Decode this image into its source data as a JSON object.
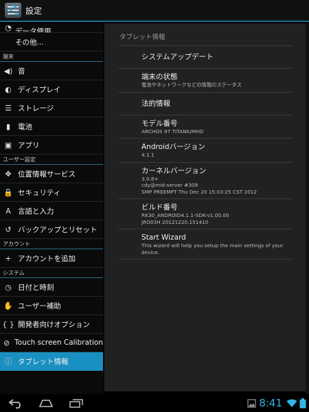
{
  "actionbar": {
    "title": "設定"
  },
  "sidebar": {
    "partial_item": "データ使用",
    "items_top": [
      {
        "label": "その他...",
        "icon": "none"
      }
    ],
    "sections": [
      {
        "header": "端末",
        "items": [
          {
            "label": "音",
            "icon": "speaker-icon",
            "glyph": "◀)"
          },
          {
            "label": "ディスプレイ",
            "icon": "brightness-icon",
            "glyph": "◐"
          },
          {
            "label": "ストレージ",
            "icon": "storage-icon",
            "glyph": "☰"
          },
          {
            "label": "電池",
            "icon": "battery-icon",
            "glyph": "▮"
          },
          {
            "label": "アプリ",
            "icon": "apps-icon",
            "glyph": "▣"
          }
        ]
      },
      {
        "header": "ユーザー設定",
        "items": [
          {
            "label": "位置情報サービス",
            "icon": "location-icon",
            "glyph": "✥"
          },
          {
            "label": "セキュリティ",
            "icon": "lock-icon",
            "glyph": "🔒"
          },
          {
            "label": "言語と入力",
            "icon": "keyboard-icon",
            "glyph": "A"
          },
          {
            "label": "バックアップとリセット",
            "icon": "backup-icon",
            "glyph": "↺"
          }
        ]
      },
      {
        "header": "アカウント",
        "items": [
          {
            "label": "アカウントを追加",
            "icon": "plus-icon",
            "glyph": "+"
          }
        ]
      },
      {
        "header": "システム",
        "items": [
          {
            "label": "日付と時刻",
            "icon": "clock-icon",
            "glyph": "◷"
          },
          {
            "label": "ユーザー補助",
            "icon": "hand-icon",
            "glyph": "✋"
          },
          {
            "label": "開発者向けオプション",
            "icon": "braces-icon",
            "glyph": "{ }"
          },
          {
            "label": "Touch screen Calibration",
            "icon": "calibration-icon",
            "glyph": "⊘"
          },
          {
            "label": "タブレット情報",
            "icon": "info-icon",
            "glyph": "ⓘ",
            "selected": true
          }
        ]
      }
    ]
  },
  "panel": {
    "header": "タブレット情報",
    "prefs": [
      {
        "title": "システムアップデート",
        "summary": "",
        "big": true
      },
      {
        "title": "端末の状態",
        "summary": "電池やネットワークなどの情報のステータス"
      },
      {
        "title": "法的情報",
        "summary": "",
        "big": true
      },
      {
        "title": "モデル番号",
        "summary": "ARCHOS 97 TITANIUMHD"
      },
      {
        "title": "Androidバージョン",
        "summary": "4.1.1"
      },
      {
        "title": "カーネルバージョン",
        "summary": "3.0.8+\ncdy@mid-server #309\nSMP PREEMPT Thu Dec 20 15:03:25 CST 2012"
      },
      {
        "title": "ビルド番号",
        "summary": "RK30_ANDROID4.1.1-SDK-v1.00.00\nJRO03H 20121220.151410"
      },
      {
        "title": "Start Wizard",
        "summary": "This wizard will help you setup the main settings of your device."
      }
    ]
  },
  "statusbar": {
    "time": "8:41"
  },
  "colors": {
    "accent": "#33b5e5",
    "selected": "#1a8fc2"
  }
}
